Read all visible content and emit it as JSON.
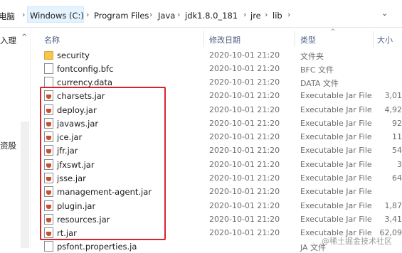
{
  "address_bar": {
    "path": [
      "电脑",
      "Windows (C:)",
      "Program Files",
      "Java",
      "jdk1.8.0_181",
      "jre",
      "lib"
    ],
    "dropdown_icon": "chevron-down-icon"
  },
  "nav_pane": {
    "items": [
      "入理",
      "资股"
    ]
  },
  "columns": {
    "name": "名称",
    "date": "修改日期",
    "type": "类型",
    "size": "大小"
  },
  "files": [
    {
      "name": "security",
      "date": "2020-10-01 21:20",
      "type": "文件夹",
      "size": "",
      "icon": "folder"
    },
    {
      "name": "fontconfig.bfc",
      "date": "2020-10-01 21:20",
      "type": "BFC 文件",
      "size": "",
      "icon": "doc"
    },
    {
      "name": "currency.data",
      "date": "2020-10-01 21:20",
      "type": "DATA 文件",
      "size": "",
      "icon": "doc"
    },
    {
      "name": "charsets.jar",
      "date": "2020-10-01 21:20",
      "type": "Executable Jar File",
      "size": "3,01",
      "icon": "jar"
    },
    {
      "name": "deploy.jar",
      "date": "2020-10-01 21:20",
      "type": "Executable Jar File",
      "size": "4,92",
      "icon": "jar"
    },
    {
      "name": "javaws.jar",
      "date": "2020-10-01 21:20",
      "type": "Executable Jar File",
      "size": "92",
      "icon": "jar"
    },
    {
      "name": "jce.jar",
      "date": "2020-10-01 21:20",
      "type": "Executable Jar File",
      "size": "11",
      "icon": "jar"
    },
    {
      "name": "jfr.jar",
      "date": "2020-10-01 21:20",
      "type": "Executable Jar File",
      "size": "54",
      "icon": "jar"
    },
    {
      "name": "jfxswt.jar",
      "date": "2020-10-01 21:20",
      "type": "Executable Jar File",
      "size": "3",
      "icon": "jar"
    },
    {
      "name": "jsse.jar",
      "date": "2020-10-01 21:20",
      "type": "Executable Jar File",
      "size": "64",
      "icon": "jar"
    },
    {
      "name": "management-agent.jar",
      "date": "2020-10-01 21:20",
      "type": "Executable Jar File",
      "size": "",
      "icon": "jar"
    },
    {
      "name": "plugin.jar",
      "date": "2020-10-01 21:20",
      "type": "Executable Jar File",
      "size": "1,87",
      "icon": "jar"
    },
    {
      "name": "resources.jar",
      "date": "2020-10-01 21:20",
      "type": "Executable Jar File",
      "size": "3,41",
      "icon": "jar"
    },
    {
      "name": "rt.jar",
      "date": "2020-10-01 21:20",
      "type": "Executable Jar File",
      "size": "62,09",
      "icon": "jar"
    },
    {
      "name": "psfont.properties.ja",
      "date": "",
      "type": "JA 文件",
      "size": "",
      "icon": "doc"
    }
  ],
  "watermark": "@稀土掘金技术社区",
  "colors": {
    "highlight": "#d9232f",
    "selection": "#e5f3ff"
  }
}
